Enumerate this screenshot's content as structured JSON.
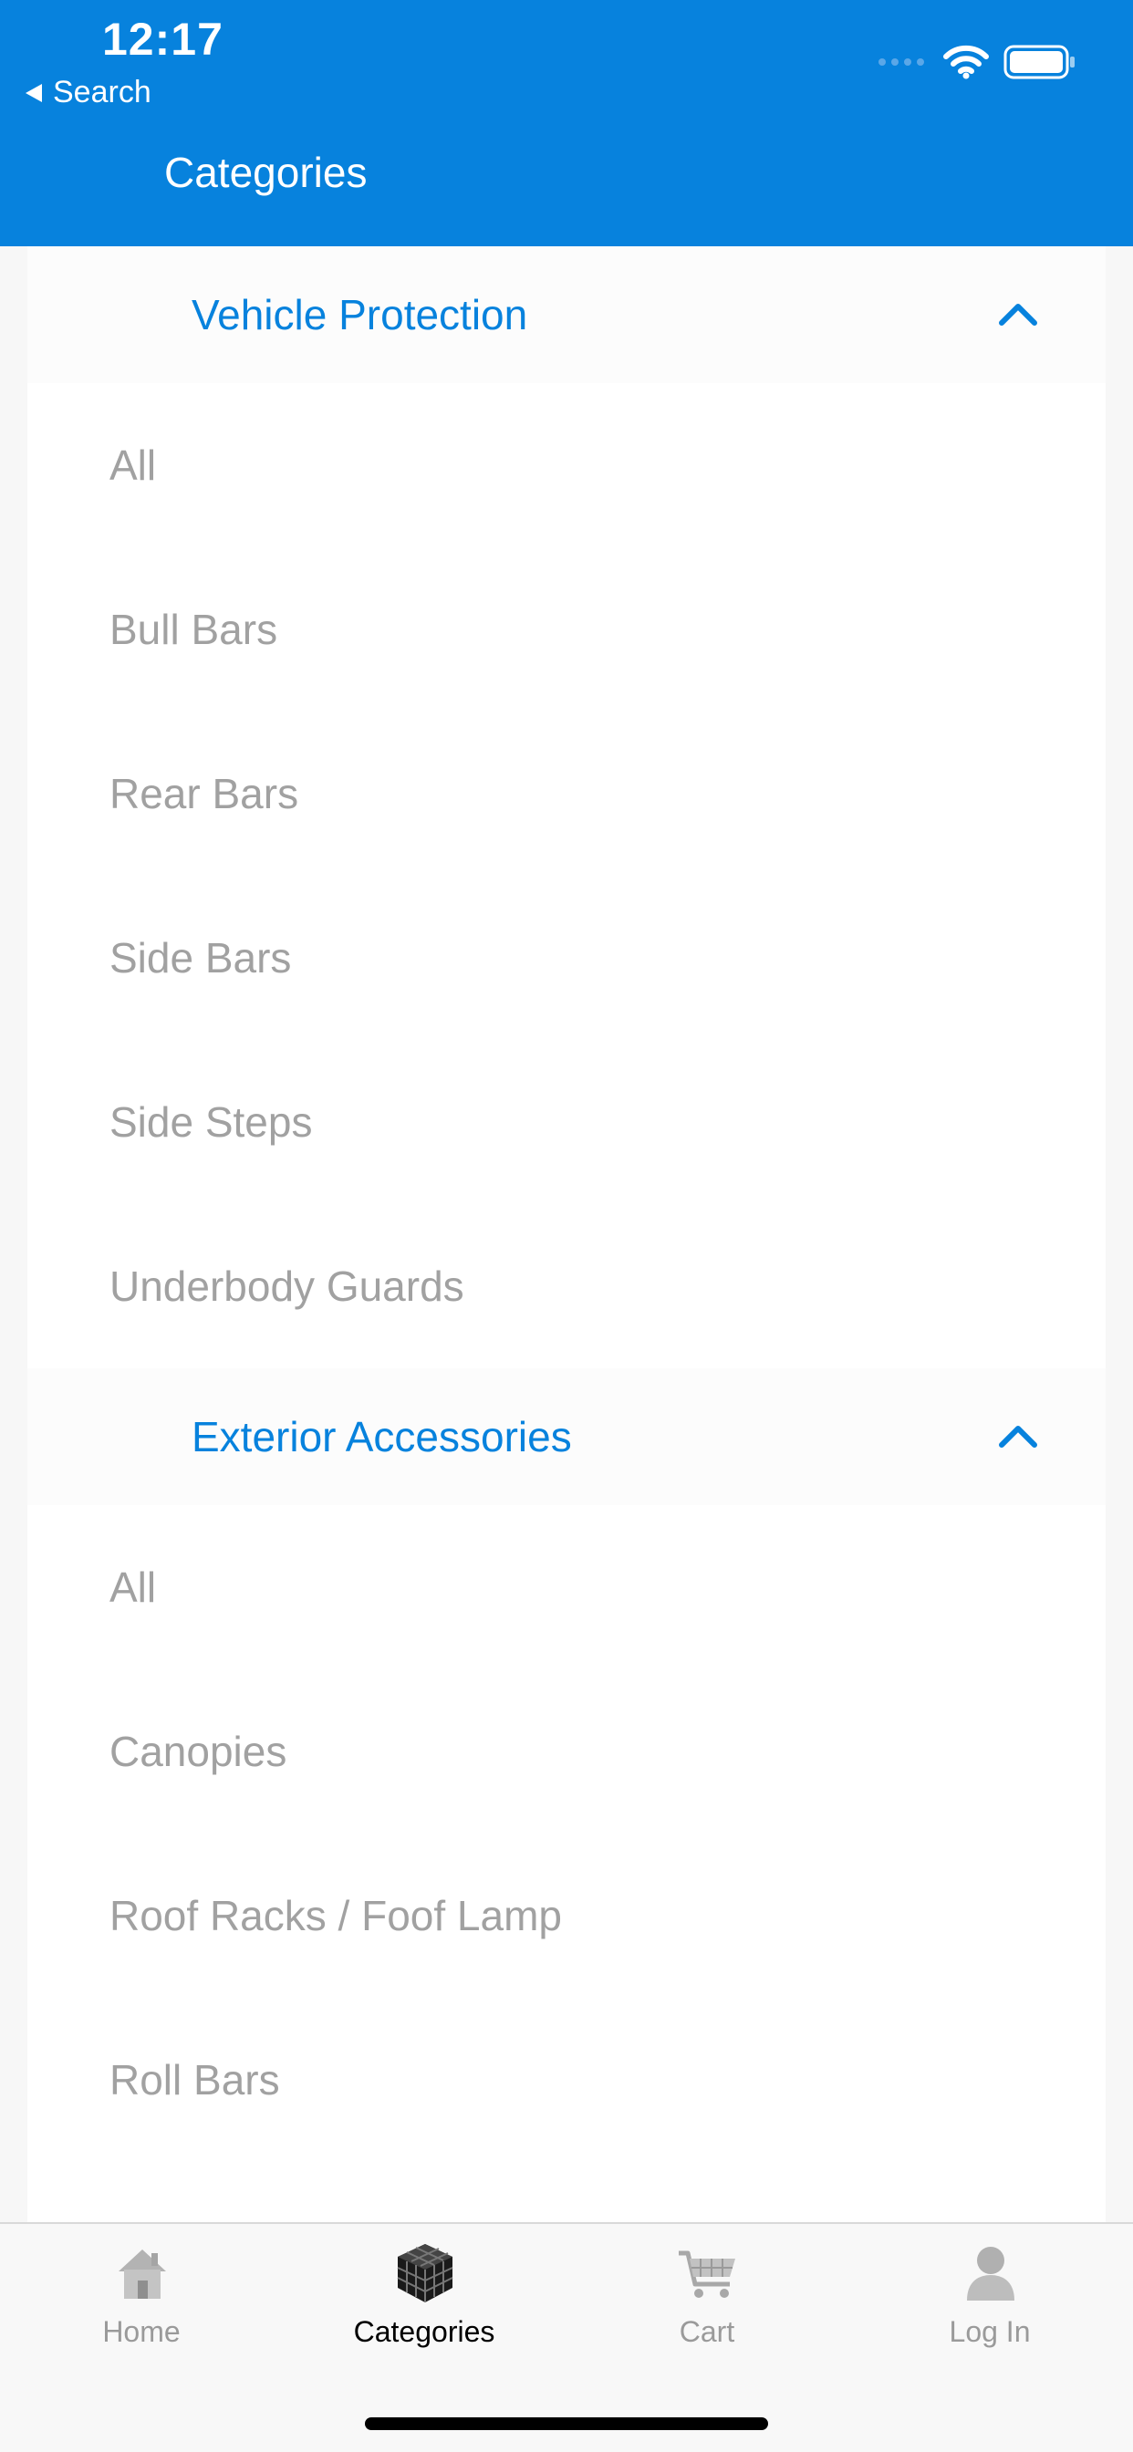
{
  "status_bar": {
    "time": "12:17",
    "back_label": "Search"
  },
  "header": {
    "title": "Categories"
  },
  "sections": [
    {
      "title": "Vehicle Protection",
      "expanded": true,
      "items": [
        "All",
        "Bull Bars",
        "Rear Bars",
        "Side Bars",
        "Side Steps",
        "Underbody Guards"
      ]
    },
    {
      "title": "Exterior Accessories",
      "expanded": true,
      "items": [
        "All",
        "Canopies",
        "Roof Racks / Foof Lamp",
        "Roll Bars"
      ]
    }
  ],
  "tabbar": {
    "tabs": [
      {
        "label": "Home",
        "icon": "home-icon",
        "active": false
      },
      {
        "label": "Categories",
        "icon": "categories-icon",
        "active": true
      },
      {
        "label": "Cart",
        "icon": "cart-icon",
        "active": false
      },
      {
        "label": "Log In",
        "icon": "user-icon",
        "active": false
      }
    ]
  },
  "colors": {
    "brand_blue": "#0782dd",
    "item_text": "#a1a1a1",
    "tab_inactive": "#9a9a9a",
    "tab_active": "#000000"
  }
}
